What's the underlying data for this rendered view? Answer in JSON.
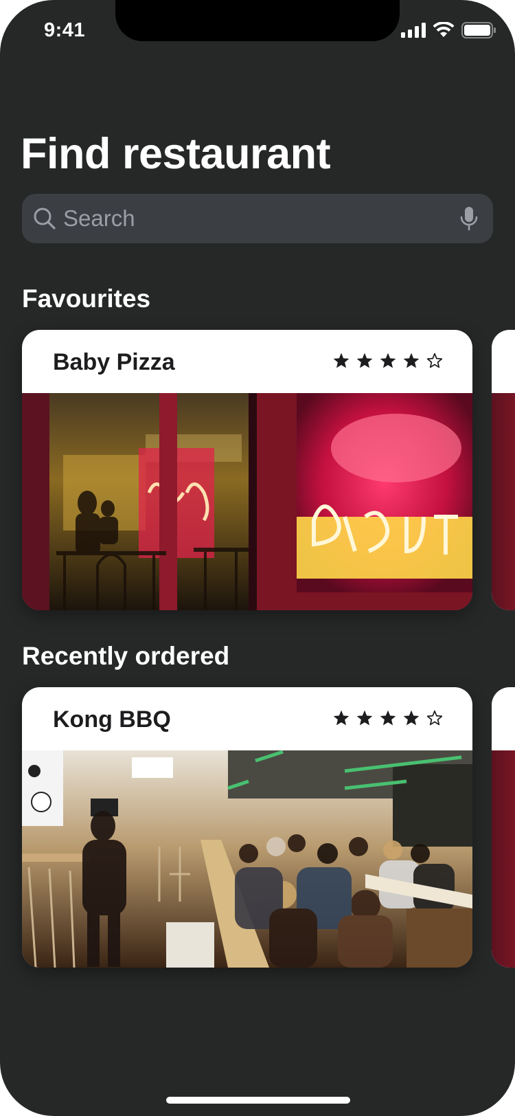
{
  "status_bar": {
    "time": "9:41"
  },
  "header": {
    "title": "Find restaurant"
  },
  "search": {
    "placeholder": "Search"
  },
  "favourites": {
    "title": "Favourites",
    "card": {
      "name": "Baby Pizza",
      "rating": 4,
      "max_rating": 5
    }
  },
  "recent": {
    "title": "Recently ordered",
    "card": {
      "name": "Kong BBQ",
      "rating": 4,
      "max_rating": 5
    }
  },
  "colors": {
    "background": "#262828",
    "search_field": "#3b3e42",
    "card": "#ffffff",
    "text_dark": "#1d1d1f"
  }
}
